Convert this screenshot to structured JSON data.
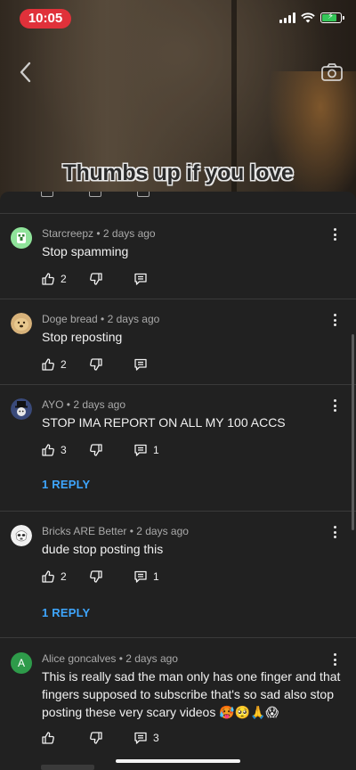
{
  "status_bar": {
    "time": "10:05"
  },
  "video": {
    "caption": "Thumbs up if you love"
  },
  "comments": [
    {
      "author": "Starcreepz",
      "age": "2 days ago",
      "meta": "Starcreepz • 2 days ago",
      "text": "Stop spamming",
      "likes": "2",
      "replies": "",
      "reply_link": ""
    },
    {
      "author": "Doge bread",
      "age": "2 days ago",
      "meta": "Doge bread • 2 days ago",
      "text": "Stop reposting",
      "likes": "2",
      "replies": "",
      "reply_link": ""
    },
    {
      "author": "AYO",
      "age": "2 days ago",
      "meta": "AYO • 2 days ago",
      "text": "STOP IMA REPORT ON ALL MY 100 ACCS",
      "likes": "3",
      "replies": "1",
      "reply_link": "1 REPLY"
    },
    {
      "author": "Bricks ARE Better",
      "age": "2 days ago",
      "meta": "Bricks ARE Better • 2 days ago",
      "text": "dude stop posting this",
      "likes": "2",
      "replies": "1",
      "reply_link": "1 REPLY"
    },
    {
      "author": "Alice goncalves",
      "age": "2 days ago",
      "meta": "Alice goncalves • 2 days ago",
      "text": "This is really sad the man only has one finger and that fingers supposed to subscribe that's so sad also stop posting these very scary videos 🥵🥺🙏😱",
      "likes": "",
      "replies": "3",
      "reply_link": "",
      "avatar_letter": "A"
    }
  ],
  "colors": {
    "accent": "#3ea6ff",
    "background": "#212121",
    "time_pill": "#e0313a"
  },
  "icons": [
    "back-arrow-icon",
    "camera-icon",
    "thumbs-up-icon",
    "thumbs-down-icon",
    "reply-icon",
    "more-vert-icon"
  ]
}
